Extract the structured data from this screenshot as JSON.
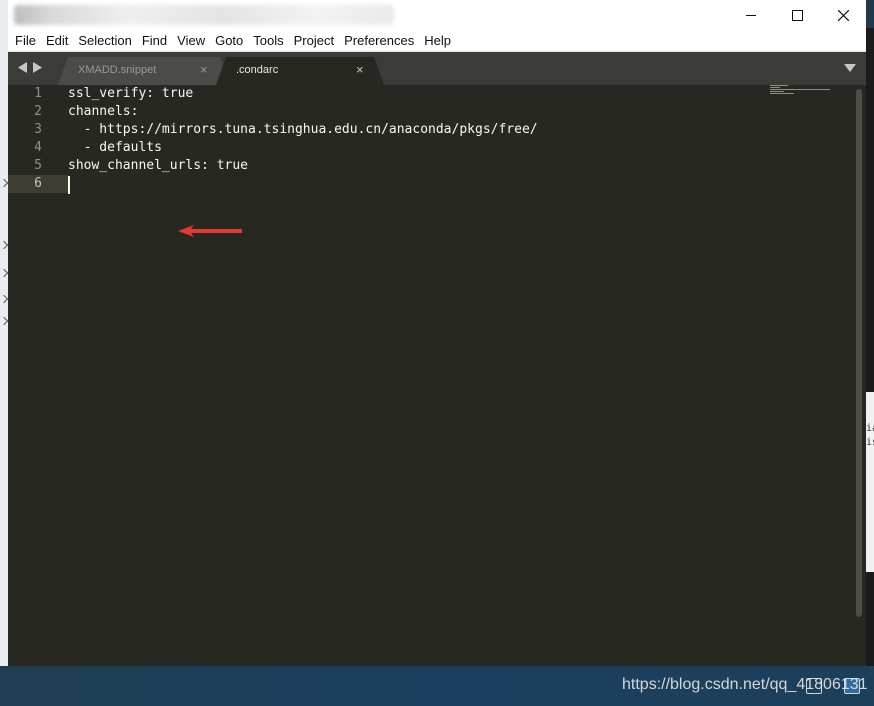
{
  "menubar": {
    "items": [
      "File",
      "Edit",
      "Selection",
      "Find",
      "View",
      "Goto",
      "Tools",
      "Project",
      "Preferences",
      "Help"
    ]
  },
  "window_controls": {
    "minimize_icon": "minimize-icon",
    "maximize_icon": "maximize-icon",
    "close_icon": "close-icon"
  },
  "tabs": [
    {
      "label": "XMADD.snippet",
      "active": false,
      "close": "×"
    },
    {
      "label": ".condarc",
      "active": true,
      "close": "×"
    }
  ],
  "editor": {
    "current_line": 6,
    "line_numbers": [
      "1",
      "2",
      "3",
      "4",
      "5",
      "6"
    ],
    "lines": [
      "ssl_verify: true",
      "channels:",
      "  - https://mirrors.tuna.tsinghua.edu.cn/anaconda/pkgs/free/",
      "  - defaults",
      "show_channel_urls: true",
      ""
    ]
  },
  "annotation": {
    "type": "arrow",
    "color": "#e53935",
    "points_to_line": 4
  },
  "background_window_right": {
    "lines": [
      "ia",
      "is"
    ]
  },
  "watermark": "https://blog.csdn.net/qq_41806131"
}
